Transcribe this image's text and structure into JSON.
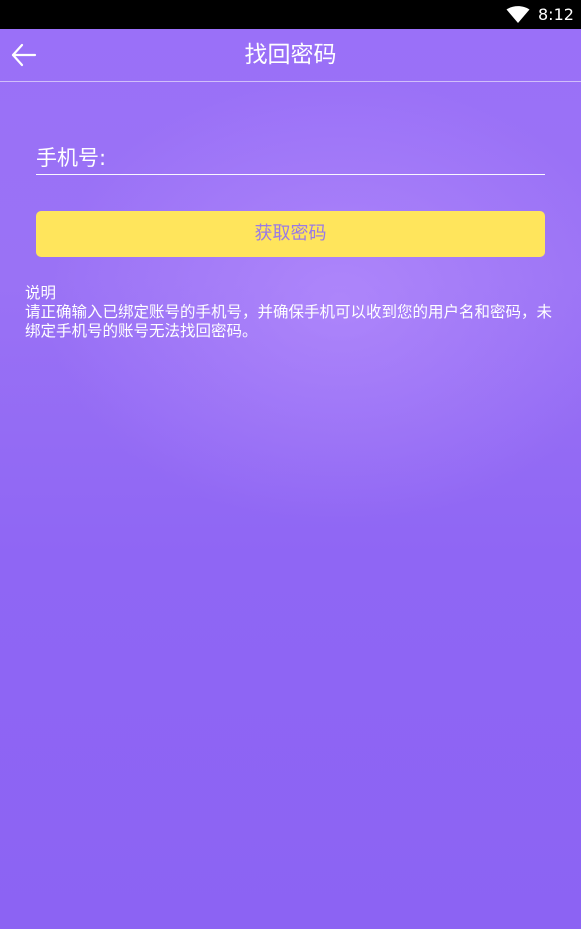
{
  "status_bar": {
    "time": "8:12",
    "wifi_icon": "wifi-icon"
  },
  "header": {
    "back_icon": "arrow-left-icon",
    "title": "找回密码"
  },
  "form": {
    "phone_label": "手机号:",
    "phone_value": "",
    "get_password_label": "获取密码"
  },
  "notes": {
    "title": "说明",
    "body": "请正确输入已绑定账号的手机号，并确保手机可以收到您的用户名和密码，未绑定手机号的账号无法找回密码。"
  },
  "colors": {
    "background": "#9a70f8",
    "button": "#ffe55c",
    "button_text": "#9a7ae6",
    "status_bar": "#000000"
  }
}
